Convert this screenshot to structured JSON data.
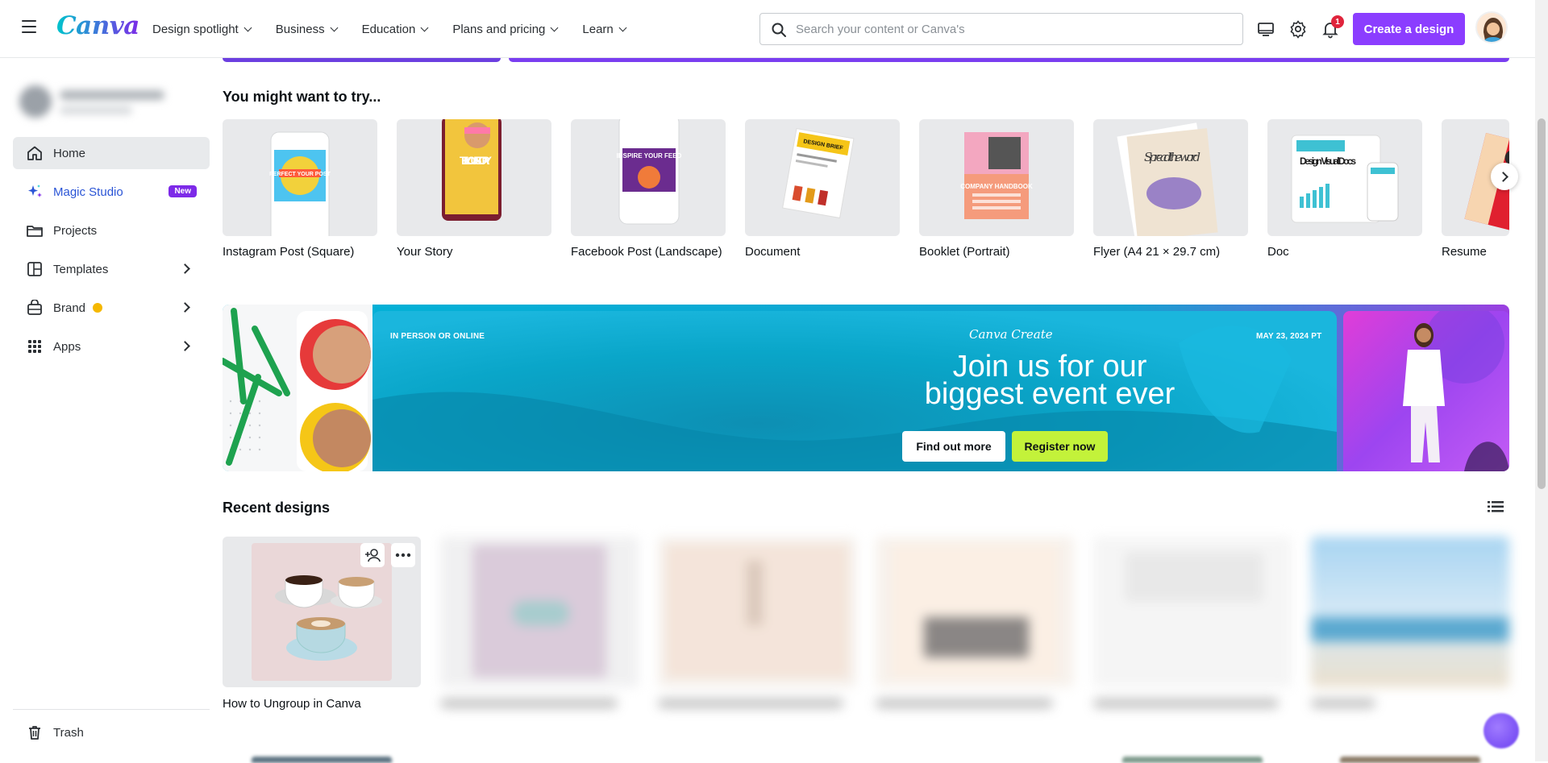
{
  "app": {
    "name": "Canva"
  },
  "nav": [
    {
      "label": "Design spotlight"
    },
    {
      "label": "Business"
    },
    {
      "label": "Education"
    },
    {
      "label": "Plans and pricing"
    },
    {
      "label": "Learn"
    }
  ],
  "search": {
    "placeholder": "Search your content or Canva's"
  },
  "header": {
    "notifications_count": "1",
    "create_label": "Create a design"
  },
  "sidebar": {
    "items": [
      {
        "label": "Home",
        "icon": "home-icon"
      },
      {
        "label": "Magic Studio",
        "icon": "sparkle-icon",
        "badge": "New"
      },
      {
        "label": "Projects",
        "icon": "folder-icon"
      },
      {
        "label": "Templates",
        "icon": "templates-icon"
      },
      {
        "label": "Brand",
        "icon": "brand-icon"
      },
      {
        "label": "Apps",
        "icon": "apps-icon"
      }
    ],
    "trash_label": "Trash"
  },
  "try": {
    "title": "You might want to try...",
    "items": [
      {
        "label": "Instagram Post (Square)",
        "thumb_text": "PERFECT YOUR POST"
      },
      {
        "label": "Your Story",
        "thumb_text": "TELL YOUR STORY"
      },
      {
        "label": "Facebook Post (Landscape)",
        "thumb_text": "INSPIRE YOUR FEED"
      },
      {
        "label": "Document",
        "thumb_text": "DESIGN BRIEF"
      },
      {
        "label": "Booklet (Portrait)",
        "thumb_text": "COMPANY HANDBOOK"
      },
      {
        "label": "Flyer (A4 21 × 29.7 cm)",
        "thumb_text": "Spread the word"
      },
      {
        "label": "Doc",
        "thumb_text": "Design Visual Docs"
      },
      {
        "label": "Resume",
        "thumb_text": ""
      }
    ]
  },
  "banner": {
    "tag_left": "IN PERSON OR ONLINE",
    "brand": "Canva Create",
    "date": "MAY 23, 2024 PT",
    "headline_line1": "Join us for our",
    "headline_line2": "biggest event ever",
    "btn_primary": "Find out more",
    "btn_secondary": "Register now"
  },
  "recent": {
    "title": "Recent designs",
    "items": [
      {
        "label": "How to Ungroup in Canva"
      }
    ]
  },
  "colors": {
    "accent": "#8b3dff",
    "lime": "#c3f23a",
    "banner_blue": "#0aa6c9"
  }
}
